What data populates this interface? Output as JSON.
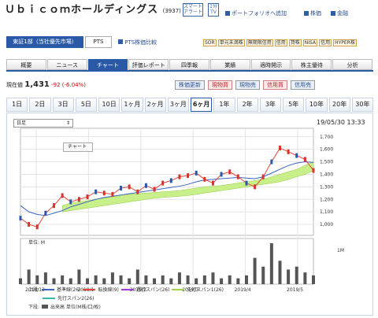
{
  "header": {
    "title": "Ｕｂｉｃｏｍホールディングス",
    "code": "(3937)",
    "smart_alert": [
      "スマート",
      "アラート"
    ],
    "rtv": [
      "1分",
      "TV"
    ],
    "portfolio_link": "ポートフォリオへ追加",
    "kabuka_link": "株価",
    "kinkai_link": "金融"
  },
  "market": {
    "main_label": "東証1部（当社優先市場）",
    "pts_label": "PTS",
    "pts_link": "PTS株価比較",
    "tags": [
      "SOR",
      "単元未満株",
      "無期限信用",
      "信用",
      "貸株",
      "NISA",
      "信用",
      "HYPER株"
    ]
  },
  "nav": {
    "tabs": [
      "概要",
      "ニュース",
      "チャート",
      "評価レポート",
      "四季報",
      "業績",
      "適時開示",
      "株主優待",
      "分析"
    ],
    "active": "チャート"
  },
  "quote": {
    "label": "現在値",
    "price": "1,431",
    "change": "-92 (-6.04%)"
  },
  "actions": {
    "minikabu": "株価更新",
    "spot_buy": "現物買",
    "spot_sell": "現物売",
    "margin_buy": "信用買",
    "margin_sell": "信用売"
  },
  "periods": {
    "items": [
      "1日",
      "2日",
      "3日",
      "5日",
      "10日",
      "1ヶ月",
      "2ヶ月",
      "3ヶ月",
      "6ヶ月",
      "1年",
      "2年",
      "3年",
      "5年",
      "10年",
      "20年",
      "30年"
    ],
    "active": "6ヶ月"
  },
  "chart_controls": {
    "select_value": "日足",
    "datetime": "19/05/30 13:33",
    "tooltip": "チャート"
  },
  "chart_data": {
    "type": "line",
    "x_ticks": [
      "2018/12",
      "2019/1",
      "2019/2",
      "2019/3",
      "2019/4",
      "2019/5"
    ],
    "y_ticks": [
      "1,700",
      "1,600",
      "1,500",
      "1,400",
      "1,300",
      "1,200",
      "1,100",
      "1,000"
    ],
    "ylim": [
      950,
      1730
    ],
    "volume_label": "単位: M",
    "volume_tick": "1M",
    "close": [
      1050,
      1000,
      980,
      1090,
      1150,
      1230,
      1180,
      1200,
      1220,
      1260,
      1250,
      1240,
      1290,
      1300,
      1260,
      1310,
      1280,
      1330,
      1350,
      1380,
      1390,
      1410,
      1360,
      1330,
      1400,
      1420,
      1380,
      1330,
      1300,
      1380,
      1500,
      1610,
      1580,
      1550,
      1520,
      1431
    ],
    "ma25": [
      1150,
      1100,
      1080,
      1070,
      1090,
      1110,
      1140,
      1160,
      1180,
      1200,
      1215,
      1225,
      1235,
      1245,
      1255,
      1265,
      1275,
      1285,
      1295,
      1305,
      1320,
      1340,
      1355,
      1360,
      1365,
      1370,
      1375,
      1370,
      1365,
      1380,
      1410,
      1440,
      1470,
      1490,
      1500,
      1495
    ],
    "cloud_top": [
      null,
      null,
      null,
      null,
      null,
      1150,
      1170,
      1180,
      1190,
      1200,
      1210,
      1220,
      1230,
      1240,
      1245,
      1250,
      1255,
      1260,
      1265,
      1270,
      1280,
      1290,
      1300,
      1305,
      1310,
      1320,
      1330,
      1340,
      1350,
      1360,
      1380,
      1400,
      1420,
      1440,
      1470,
      1500
    ],
    "cloud_bottom": [
      null,
      null,
      null,
      null,
      null,
      1100,
      1110,
      1120,
      1130,
      1140,
      1150,
      1160,
      1170,
      1180,
      1190,
      1200,
      1210,
      1215,
      1220,
      1225,
      1230,
      1240,
      1250,
      1260,
      1270,
      1280,
      1290,
      1300,
      1310,
      1320,
      1330,
      1340,
      1360,
      1380,
      1400,
      1430
    ],
    "volume": [
      0.2,
      0.5,
      0.3,
      0.4,
      0.2,
      0.3,
      0.2,
      0.5,
      0.2,
      0.3,
      0.2,
      0.4,
      0.3,
      0.2,
      0.5,
      0.3,
      0.2,
      0.3,
      0.2,
      0.4,
      0.3,
      0.2,
      0.3,
      0.4,
      0.2,
      0.3,
      0.2,
      0.3,
      0.9,
      0.6,
      1.4,
      0.8,
      0.5,
      0.6,
      0.4,
      0.3
    ]
  },
  "legend": {
    "label_top": "上段:",
    "label_bottom": "下段:",
    "items": [
      "基準線(26)",
      "転換線(9)",
      "遅行スパン(26)",
      "先行スパン1(26)",
      "先行スパン2(26)"
    ],
    "volume_item": "出来高 単位(M株/口/枚)",
    "colors": [
      "#3a66c4",
      "#e2463a",
      "#a63ad8",
      "#9fd24e",
      "#3ab7a6"
    ]
  }
}
